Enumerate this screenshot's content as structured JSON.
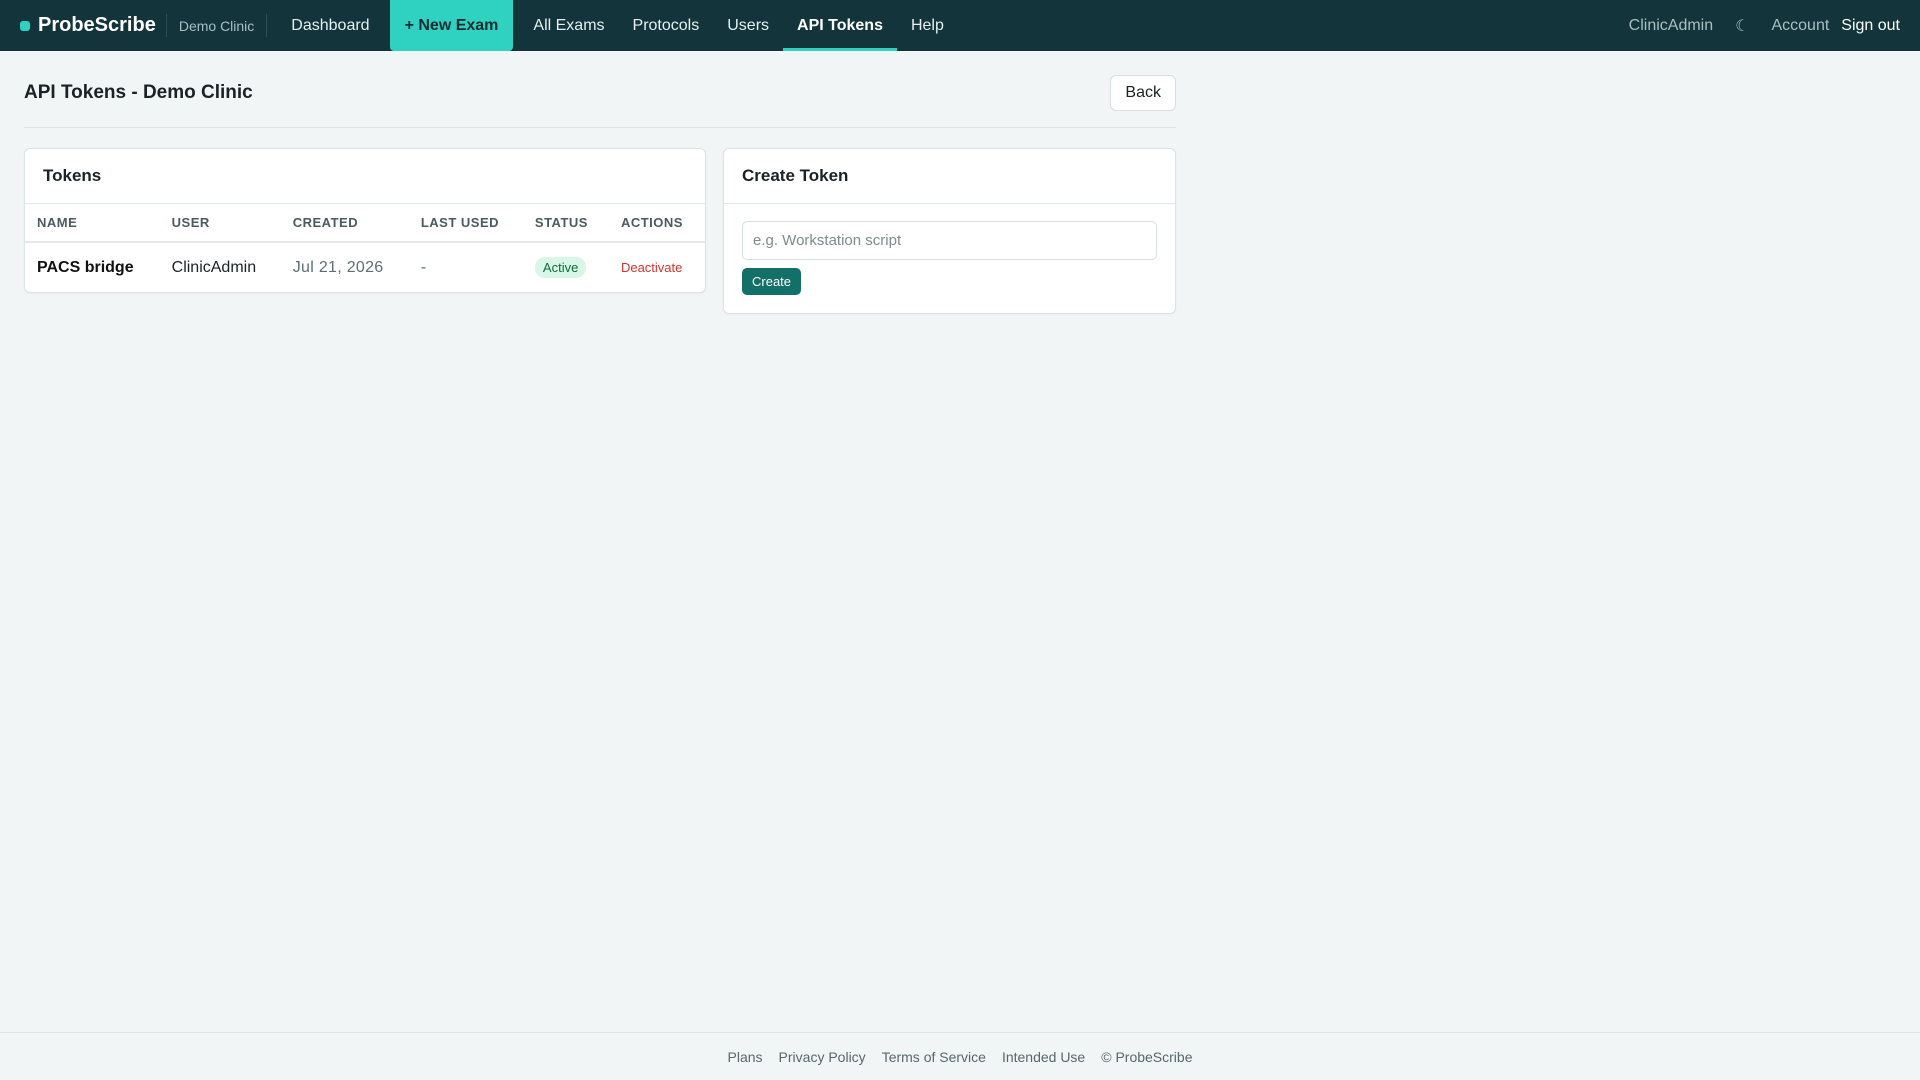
{
  "nav": {
    "brand": "ProbeScribe",
    "clinic": "Demo Clinic",
    "items": [
      {
        "label": "Dashboard"
      },
      {
        "label": "+ New Exam"
      },
      {
        "label": "All Exams"
      },
      {
        "label": "Protocols"
      },
      {
        "label": "Users"
      },
      {
        "label": "API Tokens"
      },
      {
        "label": "Help"
      }
    ],
    "active_item": "API Tokens",
    "user": "ClinicAdmin",
    "theme_icon": "☾",
    "account": "Account",
    "signout": "Sign out"
  },
  "page": {
    "title": "API Tokens - Demo Clinic",
    "back_label": "Back"
  },
  "tokens": {
    "title": "Tokens",
    "columns": [
      "NAME",
      "USER",
      "CREATED",
      "LAST USED",
      "STATUS",
      "ACTIONS"
    ],
    "rows": [
      {
        "name": "PACS bridge",
        "user": "ClinicAdmin",
        "created": "Jul 21, 2026",
        "last_used": "-",
        "status": "Active",
        "action": "Deactivate"
      }
    ]
  },
  "create": {
    "title": "Create Token",
    "placeholder": "e.g. Workstation script",
    "value": "",
    "button_label": "Create"
  },
  "footer": {
    "links": [
      "Plans",
      "Privacy Policy",
      "Terms of Service",
      "Intended Use"
    ],
    "copyright": "© ProbeScribe"
  },
  "colors": {
    "navbar": "#12343a",
    "accent": "#2fd1c0",
    "primary_button": "#137068",
    "danger": "#d0342c",
    "status_active_bg": "#d9f6e6"
  }
}
